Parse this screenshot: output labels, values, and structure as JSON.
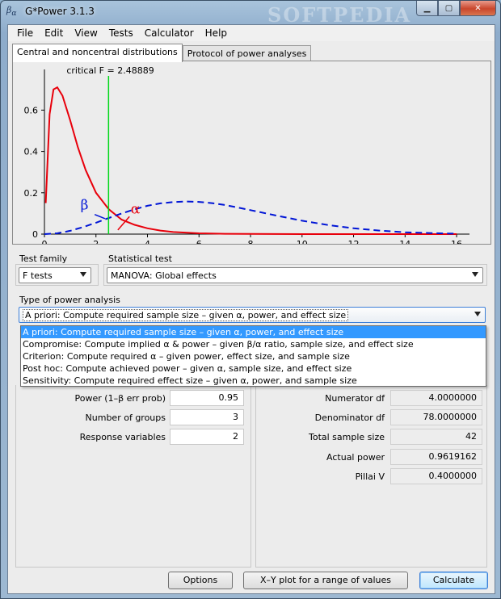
{
  "window": {
    "title": "G*Power 3.1.3",
    "watermark": "SOFTPEDIA",
    "icon": "gpower-app-icon"
  },
  "menu": [
    "File",
    "Edit",
    "View",
    "Tests",
    "Calculator",
    "Help"
  ],
  "tabs": [
    {
      "label": "Central and noncentral distributions",
      "active": true
    },
    {
      "label": "Protocol of power analyses",
      "active": false
    }
  ],
  "chart_data": {
    "type": "line",
    "title": "",
    "critical_label": "critical F = 2.48889",
    "critical_f": 2.48889,
    "xlim": [
      0,
      16.5
    ],
    "ylim": [
      0,
      0.75
    ],
    "x_ticks": [
      "0",
      "2",
      "4",
      "6",
      "8",
      "10",
      "12",
      "14",
      "16"
    ],
    "x_tick_values": [
      0,
      2,
      4,
      6,
      8,
      10,
      12,
      14,
      16
    ],
    "y_ticks": [
      "0",
      "0.2",
      "0.4",
      "0.6"
    ],
    "y_tick_values": [
      0,
      0.2,
      0.4,
      0.6
    ],
    "series": [
      {
        "x": [
          0.05,
          0.2,
          0.35,
          0.5,
          0.7,
          1.0,
          1.3,
          1.6,
          2.0,
          2.5,
          3.0,
          3.5,
          4.0,
          4.5,
          5.0,
          6.0,
          7.0,
          8.0,
          10.0,
          16.0
        ],
        "values": [
          0.15,
          0.58,
          0.7,
          0.71,
          0.67,
          0.55,
          0.42,
          0.31,
          0.2,
          0.12,
          0.07,
          0.045,
          0.028,
          0.017,
          0.01,
          0.004,
          0.0015,
          0.0006,
          0.0001,
          0.0
        ],
        "color": "#e8000b",
        "style": "solid"
      },
      {
        "x": [
          0,
          0.5,
          1,
          1.5,
          2,
          2.5,
          3,
          3.5,
          4,
          4.5,
          5,
          5.5,
          6,
          6.5,
          7,
          7.5,
          8,
          9,
          10,
          11,
          12,
          13,
          14,
          15,
          16
        ],
        "values": [
          0,
          0.004,
          0.016,
          0.034,
          0.055,
          0.078,
          0.1,
          0.12,
          0.137,
          0.149,
          0.155,
          0.158,
          0.156,
          0.15,
          0.141,
          0.129,
          0.116,
          0.09,
          0.065,
          0.044,
          0.028,
          0.017,
          0.009,
          0.005,
          0.002
        ],
        "color": "#0015d6",
        "style": "dashed"
      }
    ],
    "annotations": [
      {
        "text": "β",
        "color": "#0015d6"
      },
      {
        "text": "α",
        "color": "#e8000b"
      }
    ],
    "colors": {
      "critical": "#00d81a",
      "axis": "#000000"
    }
  },
  "test_family": {
    "label": "Test family",
    "value": "F tests"
  },
  "statistical_test": {
    "label": "Statistical test",
    "value": "MANOVA: Global effects"
  },
  "power_analysis": {
    "label": "Type of power analysis",
    "value": "A priori: Compute required sample size – given α, power, and effect size",
    "options": [
      "A priori: Compute required sample size – given α, power, and effect size",
      "Compromise: Compute implied α & power – given β/α ratio, sample size, and effect size",
      "Criterion: Compute required α – given power, effect size, and sample size",
      "Post hoc: Compute achieved power – given α, sample size, and effect size",
      "Sensitivity: Compute required effect size – given α, power, and sample size"
    ]
  },
  "inputs": [
    {
      "label": "Power (1–β err prob)",
      "value": "0.95"
    },
    {
      "label": "Number of groups",
      "value": "3"
    },
    {
      "label": "Response variables",
      "value": "2"
    }
  ],
  "outputs": [
    {
      "label": "Numerator df",
      "value": "4.0000000"
    },
    {
      "label": "Denominator df",
      "value": "78.0000000"
    },
    {
      "label": "Total sample size",
      "value": "42"
    },
    {
      "label": "Actual power",
      "value": "0.9619162"
    },
    {
      "label": "Pillai V",
      "value": "0.4000000"
    }
  ],
  "buttons": {
    "options": "Options",
    "xy_plot": "X–Y plot for a range of values",
    "calculate": "Calculate"
  }
}
